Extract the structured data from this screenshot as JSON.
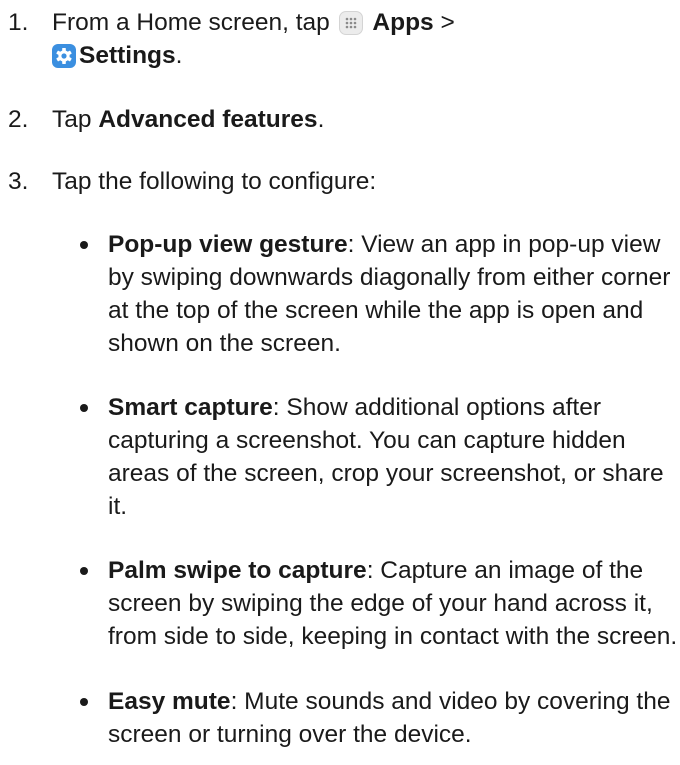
{
  "steps": [
    {
      "num": "1.",
      "pre": "From a Home screen, tap",
      "apps_label": "Apps",
      "sep": ">",
      "settings_label": "Settings",
      "end": "."
    },
    {
      "num": "2.",
      "pre": "Tap",
      "bold": "Advanced features",
      "end": "."
    },
    {
      "num": "3.",
      "text": "Tap the following to configure:"
    }
  ],
  "options": [
    {
      "title": "Pop-up view gesture",
      "desc": ": View an app in pop-up view by swiping downwards diagonally from either corner at the top of the screen while the app is open and shown on the screen."
    },
    {
      "title": "Smart capture",
      "desc": ": Show additional options after capturing a screenshot. You can capture hidden areas of the screen, crop your screenshot, or share it."
    },
    {
      "title": "Palm swipe to capture",
      "desc": ": Capture an image of the screen by swiping the edge of your hand across it, from side to side, keeping in contact with the screen."
    },
    {
      "title": "Easy mute",
      "desc": ": Mute sounds and video by covering the screen or turning over the device."
    }
  ],
  "icons": {
    "apps": "apps-grid-icon",
    "settings": "settings-gear-icon"
  },
  "colors": {
    "text": "#1a1a1a",
    "settings_icon": "#3b8fe0",
    "apps_icon_bg": "#ececec"
  }
}
